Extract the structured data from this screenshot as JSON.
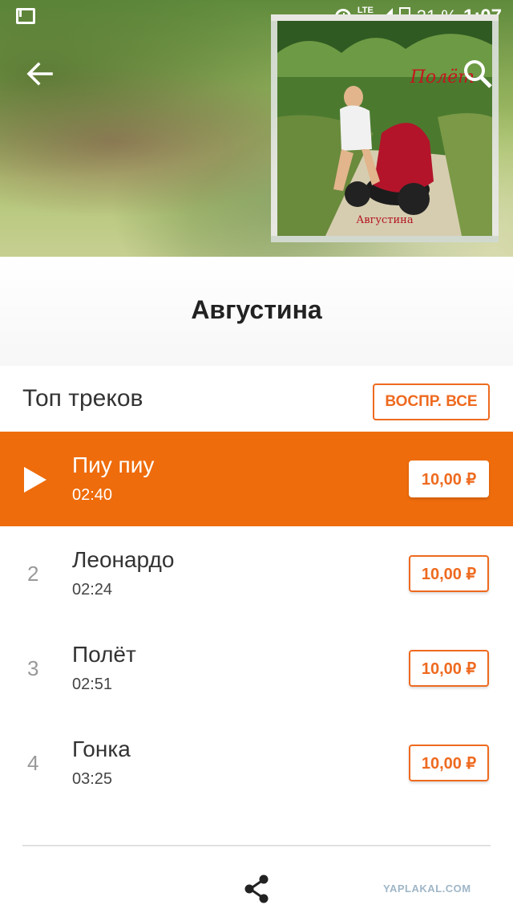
{
  "status_bar": {
    "battery": "31 %",
    "time": "1:07",
    "network": "LTE"
  },
  "album": {
    "cover_caption": "Августина",
    "cover_script": "Полёт"
  },
  "artist": {
    "name": "Августина"
  },
  "top_tracks": {
    "title": "Топ треков",
    "play_all_label": "ВОСПР. ВСЕ",
    "tracks": [
      {
        "number": "1",
        "name": "Пиу пиу",
        "duration": "02:40",
        "price": "10,00 ₽",
        "active": true
      },
      {
        "number": "2",
        "name": "Леонардо",
        "duration": "02:24",
        "price": "10,00 ₽",
        "active": false
      },
      {
        "number": "3",
        "name": "Полёт",
        "duration": "02:51",
        "price": "10,00 ₽",
        "active": false
      },
      {
        "number": "4",
        "name": "Гонка",
        "duration": "03:25",
        "price": "10,00 ₽",
        "active": false
      }
    ]
  },
  "watermark": "YAPLAKAL.COM",
  "colors": {
    "accent": "#ee6c0c"
  }
}
